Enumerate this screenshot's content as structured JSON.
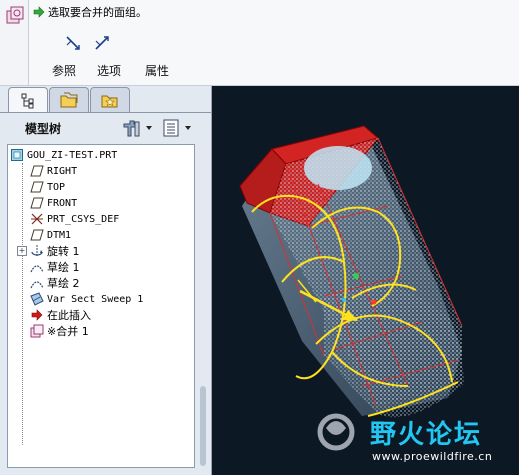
{
  "dashboard": {
    "prompt": "选取要合并的面组。",
    "tabs": [
      {
        "label": "参照"
      },
      {
        "label": "选项"
      },
      {
        "label": "属性"
      }
    ]
  },
  "panel": {
    "tree_title": "模型树",
    "items": [
      {
        "label": "GOU_ZI-TEST.PRT",
        "icon": "part-icon"
      },
      {
        "label": "RIGHT",
        "icon": "datum-plane-icon"
      },
      {
        "label": "TOP",
        "icon": "datum-plane-icon"
      },
      {
        "label": "FRONT",
        "icon": "datum-plane-icon"
      },
      {
        "label": "PRT_CSYS_DEF",
        "icon": "csys-icon"
      },
      {
        "label": "DTM1",
        "icon": "datum-plane-icon"
      },
      {
        "label": "旋转 1",
        "icon": "revolve-icon"
      },
      {
        "label": "草绘 1",
        "icon": "sketch-icon"
      },
      {
        "label": "草绘 2",
        "icon": "sketch-icon"
      },
      {
        "label": "Var Sect Sweep 1",
        "icon": "var-sect-sweep-icon"
      },
      {
        "label": "在此插入",
        "icon": "insert-here-arrow-icon"
      },
      {
        "label": "※合并 1",
        "icon": "merge-icon"
      }
    ]
  },
  "watermark": {
    "text": "野火论坛",
    "url": "www.proewildfire.cn"
  },
  "colors": {
    "viewport_bg": "#0d1825",
    "model_red": "#cc2222",
    "highlight_yellow": "#ffe21c",
    "mesh_dots": "#d8e6f2"
  }
}
